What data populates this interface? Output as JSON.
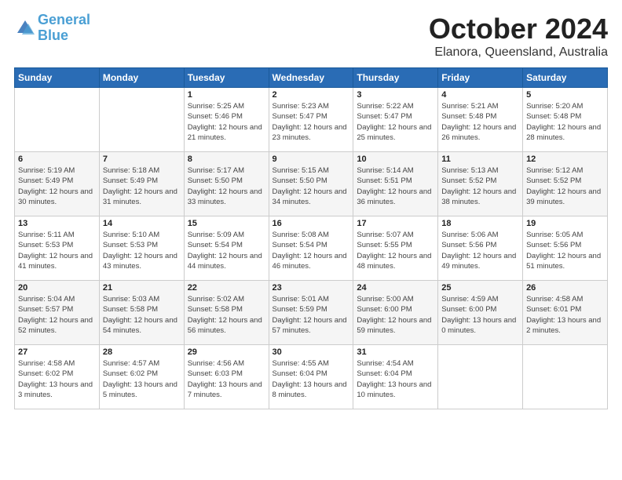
{
  "logo": {
    "line1": "General",
    "line2": "Blue"
  },
  "title": "October 2024",
  "location": "Elanora, Queensland, Australia",
  "days_header": [
    "Sunday",
    "Monday",
    "Tuesday",
    "Wednesday",
    "Thursday",
    "Friday",
    "Saturday"
  ],
  "weeks": [
    [
      {
        "num": "",
        "sunrise": "",
        "sunset": "",
        "daylight": ""
      },
      {
        "num": "",
        "sunrise": "",
        "sunset": "",
        "daylight": ""
      },
      {
        "num": "1",
        "sunrise": "Sunrise: 5:25 AM",
        "sunset": "Sunset: 5:46 PM",
        "daylight": "Daylight: 12 hours and 21 minutes."
      },
      {
        "num": "2",
        "sunrise": "Sunrise: 5:23 AM",
        "sunset": "Sunset: 5:47 PM",
        "daylight": "Daylight: 12 hours and 23 minutes."
      },
      {
        "num": "3",
        "sunrise": "Sunrise: 5:22 AM",
        "sunset": "Sunset: 5:47 PM",
        "daylight": "Daylight: 12 hours and 25 minutes."
      },
      {
        "num": "4",
        "sunrise": "Sunrise: 5:21 AM",
        "sunset": "Sunset: 5:48 PM",
        "daylight": "Daylight: 12 hours and 26 minutes."
      },
      {
        "num": "5",
        "sunrise": "Sunrise: 5:20 AM",
        "sunset": "Sunset: 5:48 PM",
        "daylight": "Daylight: 12 hours and 28 minutes."
      }
    ],
    [
      {
        "num": "6",
        "sunrise": "Sunrise: 5:19 AM",
        "sunset": "Sunset: 5:49 PM",
        "daylight": "Daylight: 12 hours and 30 minutes."
      },
      {
        "num": "7",
        "sunrise": "Sunrise: 5:18 AM",
        "sunset": "Sunset: 5:49 PM",
        "daylight": "Daylight: 12 hours and 31 minutes."
      },
      {
        "num": "8",
        "sunrise": "Sunrise: 5:17 AM",
        "sunset": "Sunset: 5:50 PM",
        "daylight": "Daylight: 12 hours and 33 minutes."
      },
      {
        "num": "9",
        "sunrise": "Sunrise: 5:15 AM",
        "sunset": "Sunset: 5:50 PM",
        "daylight": "Daylight: 12 hours and 34 minutes."
      },
      {
        "num": "10",
        "sunrise": "Sunrise: 5:14 AM",
        "sunset": "Sunset: 5:51 PM",
        "daylight": "Daylight: 12 hours and 36 minutes."
      },
      {
        "num": "11",
        "sunrise": "Sunrise: 5:13 AM",
        "sunset": "Sunset: 5:52 PM",
        "daylight": "Daylight: 12 hours and 38 minutes."
      },
      {
        "num": "12",
        "sunrise": "Sunrise: 5:12 AM",
        "sunset": "Sunset: 5:52 PM",
        "daylight": "Daylight: 12 hours and 39 minutes."
      }
    ],
    [
      {
        "num": "13",
        "sunrise": "Sunrise: 5:11 AM",
        "sunset": "Sunset: 5:53 PM",
        "daylight": "Daylight: 12 hours and 41 minutes."
      },
      {
        "num": "14",
        "sunrise": "Sunrise: 5:10 AM",
        "sunset": "Sunset: 5:53 PM",
        "daylight": "Daylight: 12 hours and 43 minutes."
      },
      {
        "num": "15",
        "sunrise": "Sunrise: 5:09 AM",
        "sunset": "Sunset: 5:54 PM",
        "daylight": "Daylight: 12 hours and 44 minutes."
      },
      {
        "num": "16",
        "sunrise": "Sunrise: 5:08 AM",
        "sunset": "Sunset: 5:54 PM",
        "daylight": "Daylight: 12 hours and 46 minutes."
      },
      {
        "num": "17",
        "sunrise": "Sunrise: 5:07 AM",
        "sunset": "Sunset: 5:55 PM",
        "daylight": "Daylight: 12 hours and 48 minutes."
      },
      {
        "num": "18",
        "sunrise": "Sunrise: 5:06 AM",
        "sunset": "Sunset: 5:56 PM",
        "daylight": "Daylight: 12 hours and 49 minutes."
      },
      {
        "num": "19",
        "sunrise": "Sunrise: 5:05 AM",
        "sunset": "Sunset: 5:56 PM",
        "daylight": "Daylight: 12 hours and 51 minutes."
      }
    ],
    [
      {
        "num": "20",
        "sunrise": "Sunrise: 5:04 AM",
        "sunset": "Sunset: 5:57 PM",
        "daylight": "Daylight: 12 hours and 52 minutes."
      },
      {
        "num": "21",
        "sunrise": "Sunrise: 5:03 AM",
        "sunset": "Sunset: 5:58 PM",
        "daylight": "Daylight: 12 hours and 54 minutes."
      },
      {
        "num": "22",
        "sunrise": "Sunrise: 5:02 AM",
        "sunset": "Sunset: 5:58 PM",
        "daylight": "Daylight: 12 hours and 56 minutes."
      },
      {
        "num": "23",
        "sunrise": "Sunrise: 5:01 AM",
        "sunset": "Sunset: 5:59 PM",
        "daylight": "Daylight: 12 hours and 57 minutes."
      },
      {
        "num": "24",
        "sunrise": "Sunrise: 5:00 AM",
        "sunset": "Sunset: 6:00 PM",
        "daylight": "Daylight: 12 hours and 59 minutes."
      },
      {
        "num": "25",
        "sunrise": "Sunrise: 4:59 AM",
        "sunset": "Sunset: 6:00 PM",
        "daylight": "Daylight: 13 hours and 0 minutes."
      },
      {
        "num": "26",
        "sunrise": "Sunrise: 4:58 AM",
        "sunset": "Sunset: 6:01 PM",
        "daylight": "Daylight: 13 hours and 2 minutes."
      }
    ],
    [
      {
        "num": "27",
        "sunrise": "Sunrise: 4:58 AM",
        "sunset": "Sunset: 6:02 PM",
        "daylight": "Daylight: 13 hours and 3 minutes."
      },
      {
        "num": "28",
        "sunrise": "Sunrise: 4:57 AM",
        "sunset": "Sunset: 6:02 PM",
        "daylight": "Daylight: 13 hours and 5 minutes."
      },
      {
        "num": "29",
        "sunrise": "Sunrise: 4:56 AM",
        "sunset": "Sunset: 6:03 PM",
        "daylight": "Daylight: 13 hours and 7 minutes."
      },
      {
        "num": "30",
        "sunrise": "Sunrise: 4:55 AM",
        "sunset": "Sunset: 6:04 PM",
        "daylight": "Daylight: 13 hours and 8 minutes."
      },
      {
        "num": "31",
        "sunrise": "Sunrise: 4:54 AM",
        "sunset": "Sunset: 6:04 PM",
        "daylight": "Daylight: 13 hours and 10 minutes."
      },
      {
        "num": "",
        "sunrise": "",
        "sunset": "",
        "daylight": ""
      },
      {
        "num": "",
        "sunrise": "",
        "sunset": "",
        "daylight": ""
      }
    ]
  ]
}
